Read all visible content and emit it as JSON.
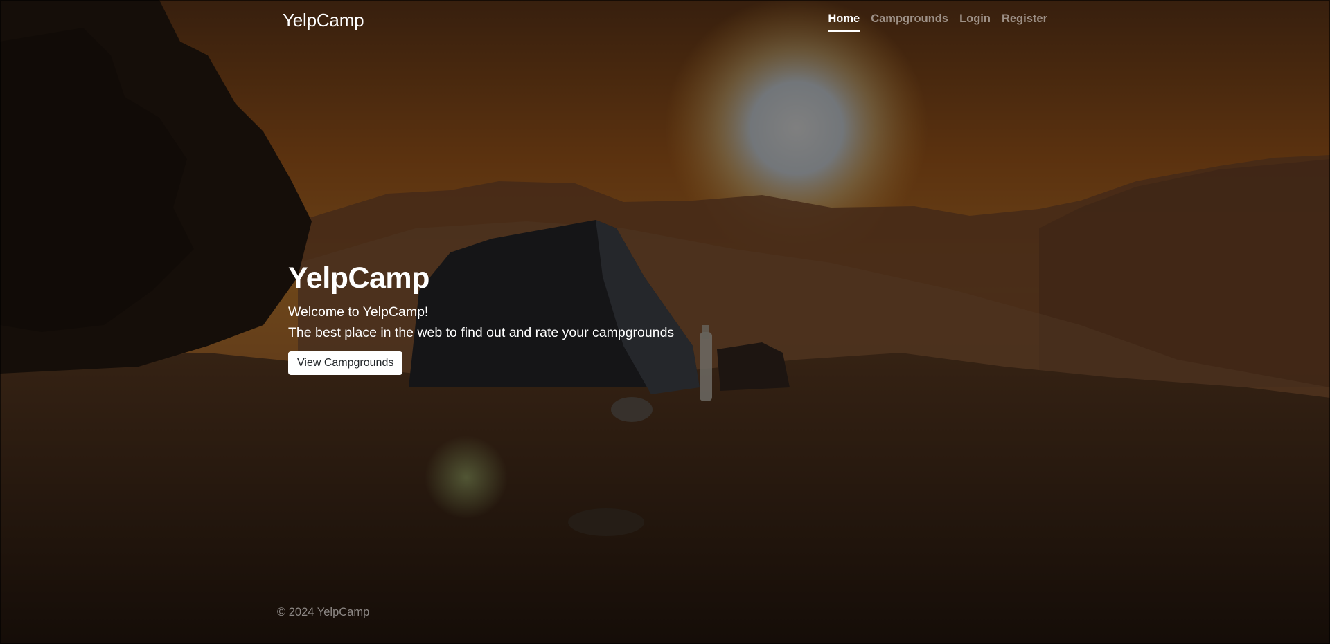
{
  "app": {
    "brand": "YelpCamp"
  },
  "nav": {
    "items": [
      {
        "label": "Home",
        "active": true
      },
      {
        "label": "Campgrounds",
        "active": false
      },
      {
        "label": "Login",
        "active": false
      },
      {
        "label": "Register",
        "active": false
      }
    ]
  },
  "hero": {
    "title": "YelpCamp",
    "welcome": "Welcome to YelpCamp!",
    "tagline": "The best place in the web to find out and rate your campgrounds",
    "button_label": "View Campgrounds",
    "background_image": "campsite-tent-at-sunset"
  },
  "footer": {
    "text": "© 2024 YelpCamp"
  },
  "colors": {
    "sky": "#b8651f",
    "overlay": "rgba(0,0,0,0.5)",
    "text": "#ffffff",
    "button_bg": "#ffffff"
  }
}
